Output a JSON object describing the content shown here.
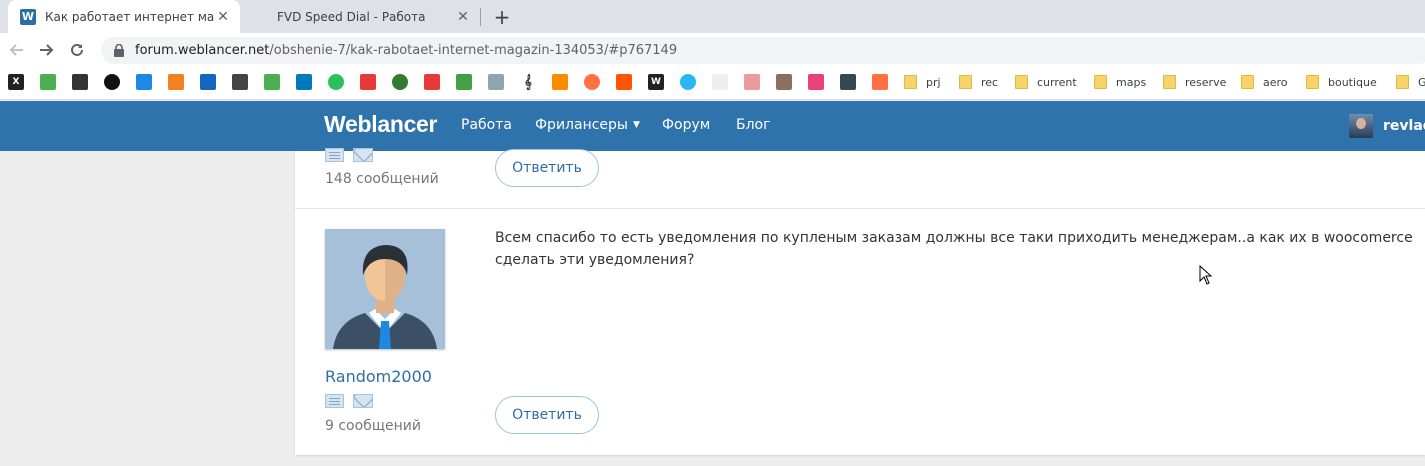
{
  "browser": {
    "tabs": [
      {
        "title": "Как работает интернет магазин",
        "favicon": "W",
        "active": true
      },
      {
        "title": "FVD Speed Dial - Работа",
        "favicon": "",
        "active": false
      }
    ],
    "new_tab": "+",
    "url": {
      "host": "forum.weblancer.net",
      "path": "/obshenie-7/kak-rabotaet-internet-magazin-134053/#p767149"
    }
  },
  "bookmarks": {
    "folders": [
      "prj",
      "rec",
      "current",
      "maps",
      "reserve",
      "aero",
      "boutique",
      "G"
    ]
  },
  "site": {
    "logo": "Weblancer",
    "nav": [
      {
        "label": "Работа"
      },
      {
        "label": "Фрилансеры"
      },
      {
        "label": "Форум"
      },
      {
        "label": "Блог"
      }
    ],
    "user_name": "revlad"
  },
  "posts": [
    {
      "message_count": "148 сообщений",
      "reply_label": "Ответить"
    },
    {
      "author": "Random2000",
      "message_count": "9 сообщений",
      "text": "Всем спасибо то есть уведомления по купленым заказам должны все таки приходить менеджерам..а как их в woocomerce сделать эти уведомления?",
      "reply_label": "Ответить"
    }
  ]
}
